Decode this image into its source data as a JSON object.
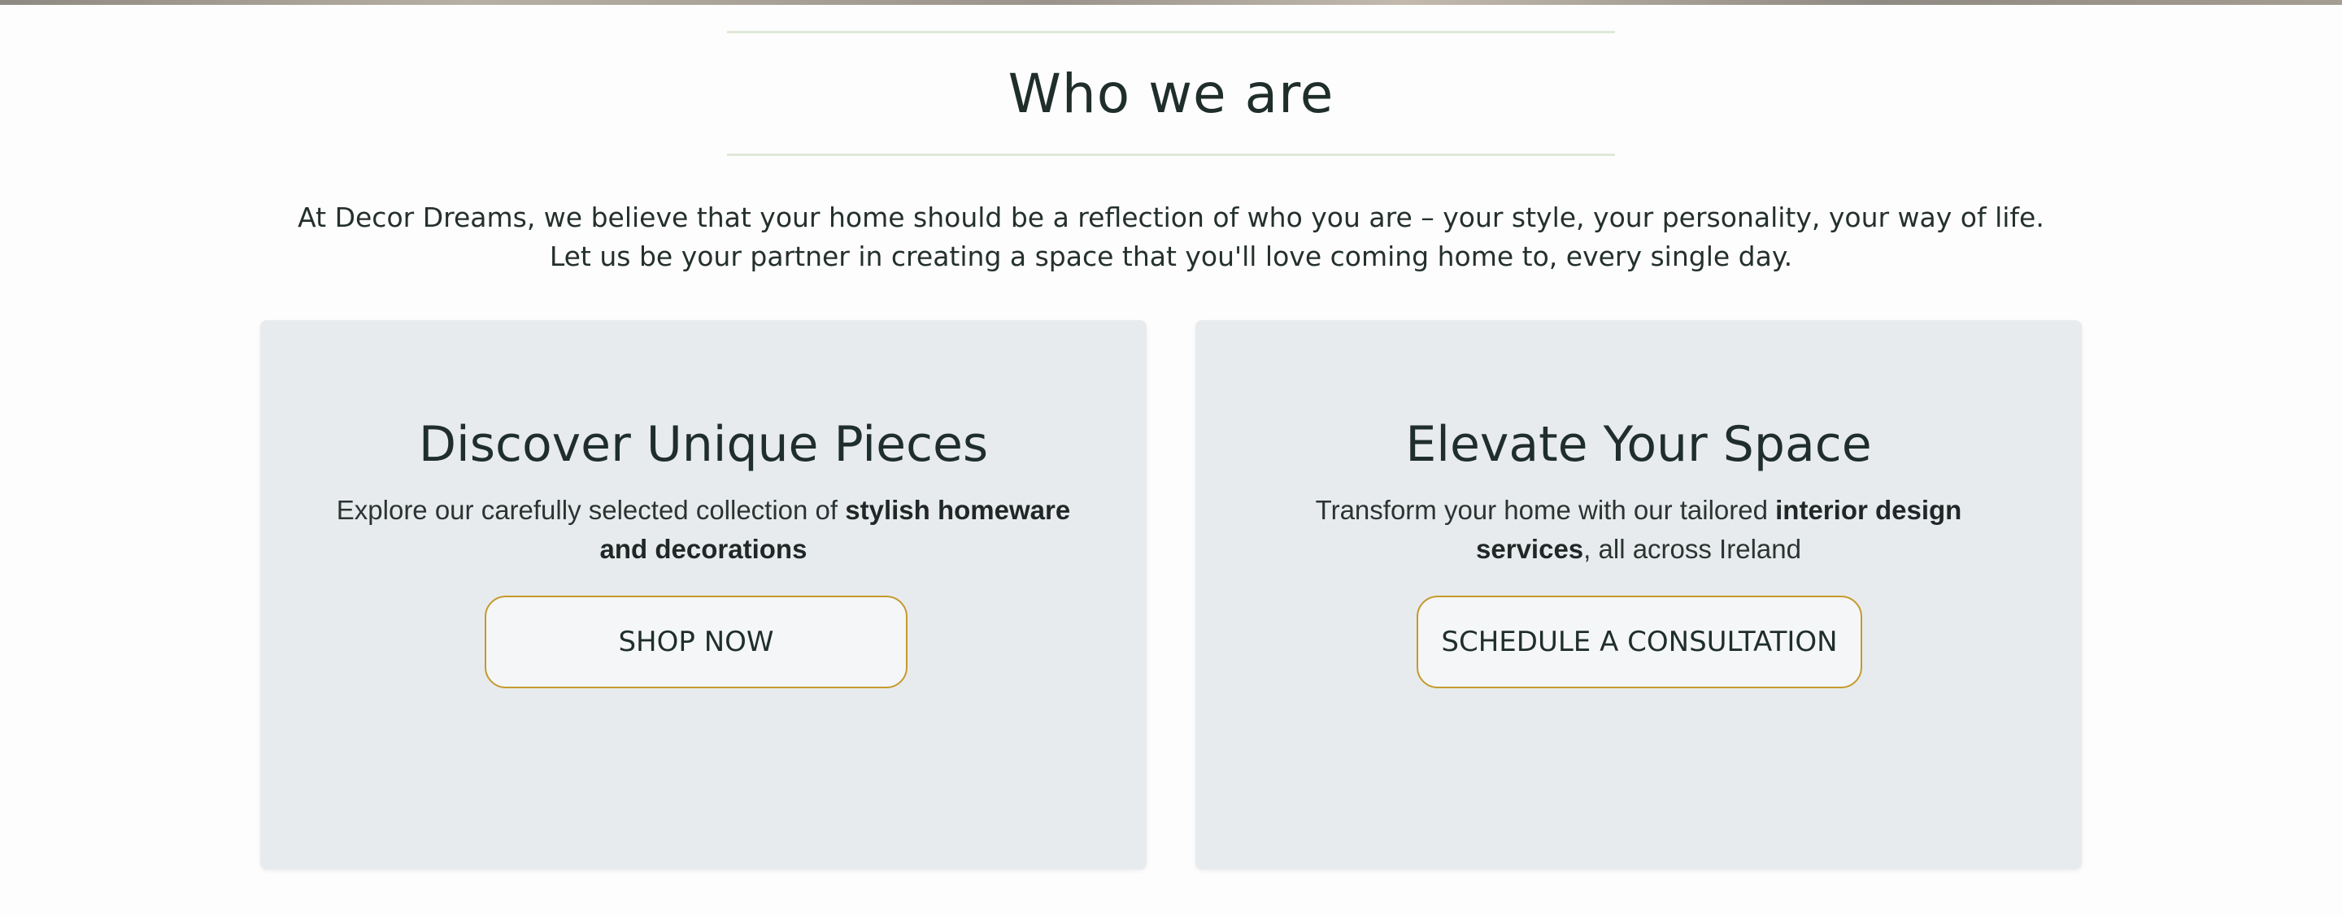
{
  "section": {
    "title": "Who we are"
  },
  "intro": {
    "line1": "At Decor Dreams, we believe that your home should be a reflection of who you are – your style, your personality, your way of life.",
    "line2": "Let us be your partner in creating a space that you'll love coming home to, every single day."
  },
  "cards": [
    {
      "title": "Discover Unique Pieces",
      "text_before": "Explore our carefully selected collection of ",
      "text_bold": "stylish homeware and decorations",
      "text_after": "",
      "button_label": "SHOP NOW"
    },
    {
      "title": "Elevate Your Space",
      "text_before": "Transform your home with our tailored ",
      "text_bold": "interior design services",
      "text_after": ", all across Ireland",
      "button_label": "SCHEDULE A CONSULTATION"
    }
  ],
  "colors": {
    "card_background": "#e8ebed",
    "button_border": "#c59a2c",
    "divider": "#dfe8d8",
    "text": "#1f2e2b"
  }
}
